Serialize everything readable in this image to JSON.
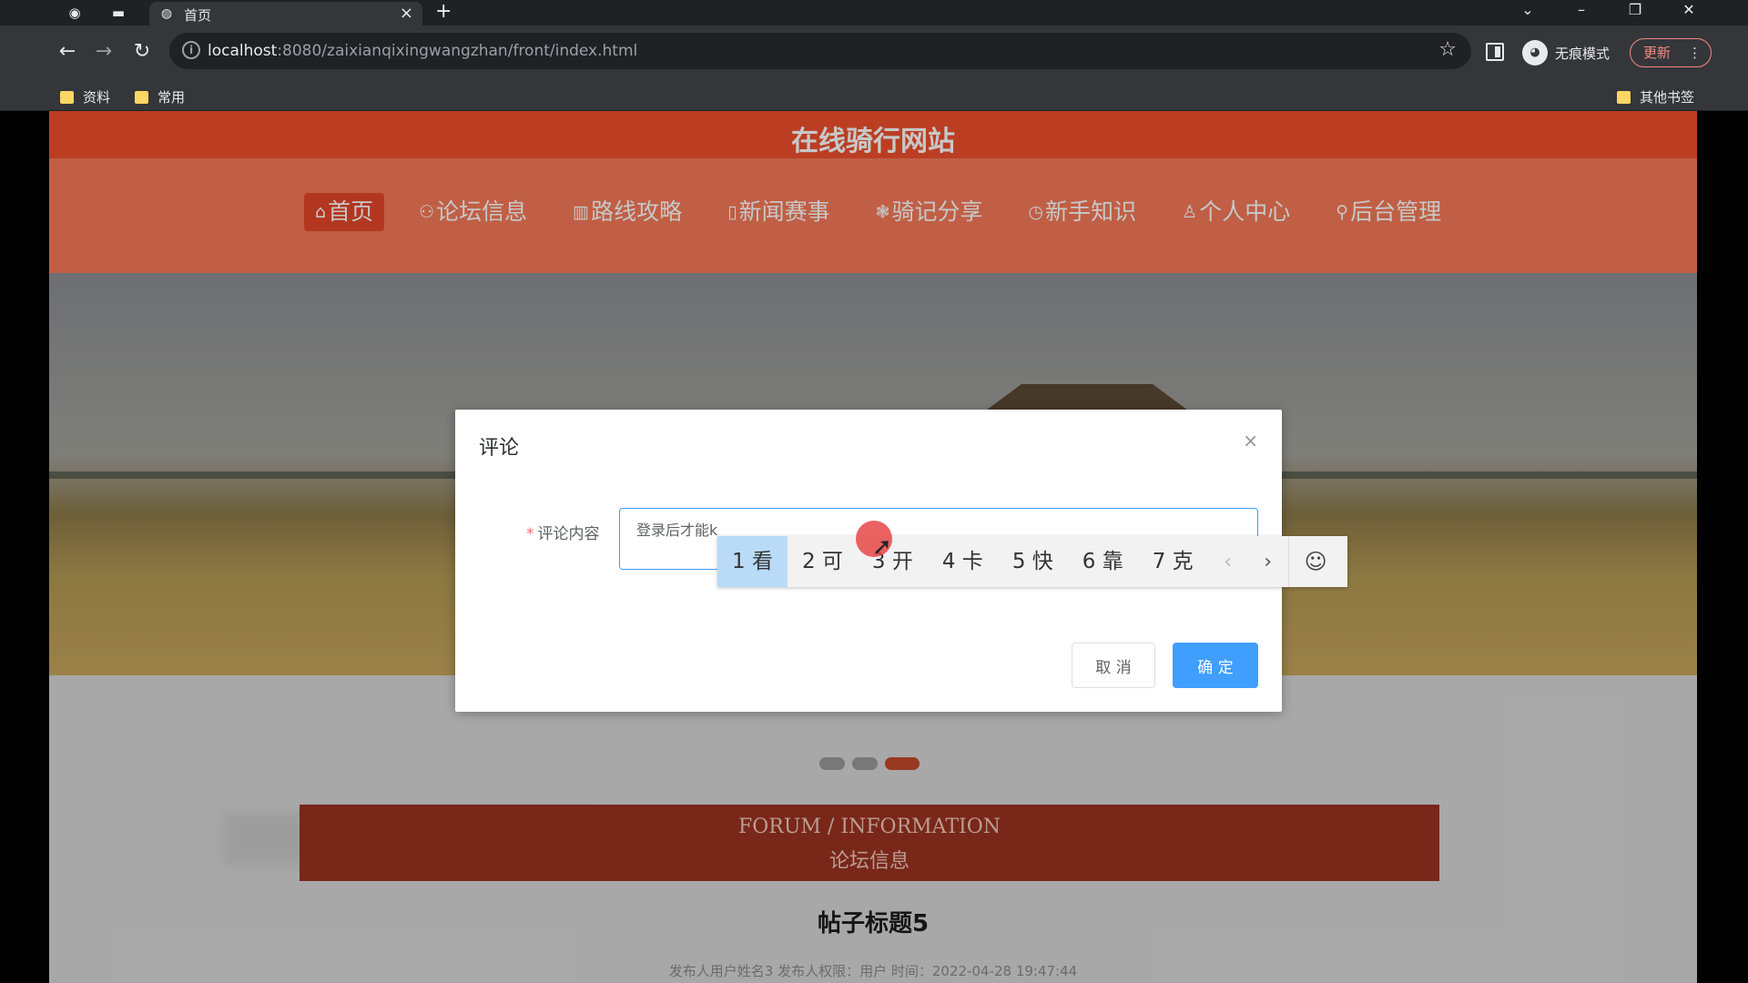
{
  "browser": {
    "tab_title": "首页",
    "tab_close": "×",
    "new_tab": "+",
    "url_host": "localhost",
    "url_rest": ":8080/zaixianqixingwangzhan/front/index.html",
    "incognito_label": "无痕模式",
    "update_label": "更新",
    "bookmarks": [
      "资料",
      "常用"
    ],
    "other_bookmarks": "其他书签"
  },
  "site": {
    "title": "在线骑行网站",
    "nav": [
      {
        "icon": "⌂",
        "label": "首页"
      },
      {
        "icon": "⚇",
        "label": "论坛信息"
      },
      {
        "icon": "▥",
        "label": "路线攻略"
      },
      {
        "icon": "▯",
        "label": "新闻赛事"
      },
      {
        "icon": "❃",
        "label": "骑记分享"
      },
      {
        "icon": "◷",
        "label": "新手知识"
      },
      {
        "icon": "♙",
        "label": "个人中心"
      },
      {
        "icon": "⚲",
        "label": "后台管理"
      }
    ]
  },
  "forum": {
    "title_en": "FORUM / INFORMATION",
    "title_cn": "论坛信息",
    "post_title": "帖子标题5",
    "post_meta": "发布人用户姓名3   发布人权限：用户   时间：2022-04-28 19:47:44"
  },
  "dialog": {
    "title": "评论",
    "close": "×",
    "field_required": "*",
    "field_label": "评论内容",
    "field_value": "登录后才能k",
    "cancel_label": "取 消",
    "confirm_label": "确 定"
  },
  "ime": {
    "candidates": [
      "1 看",
      "2 可",
      "3 开",
      "4 卡",
      "5 快",
      "6 靠",
      "7 克"
    ],
    "prev": "‹",
    "next": "›",
    "emoji": "☺"
  },
  "colors": {
    "brand": "#f0502e",
    "nav_bg": "#f67a59",
    "primary_button": "#409eff"
  }
}
